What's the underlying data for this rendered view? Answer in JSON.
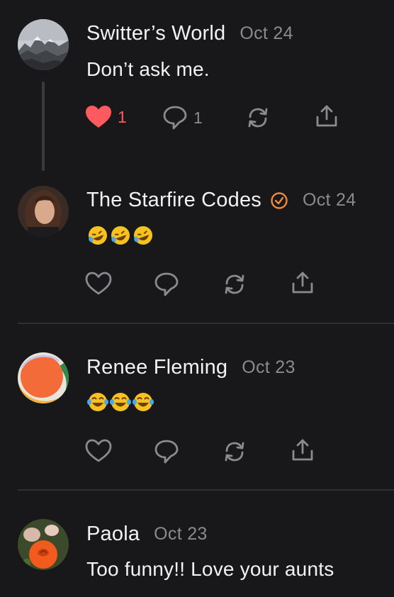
{
  "colors": {
    "background": "#18181a",
    "text": "#f2f2f2",
    "muted": "#8a8a8f",
    "like_active": "#ff5a5f",
    "verified": "#f08a3c"
  },
  "posts": [
    {
      "author": "Switter’s World",
      "date": "Oct 24",
      "text": "Don’t ask me.",
      "avatar": "mountain-landscape-avatar",
      "liked": true,
      "like_count": "1",
      "reply_count": "1"
    },
    {
      "author": "The Starfire Codes",
      "date": "Oct 24",
      "verified": true,
      "emoji": [
        "🤣",
        "🤣",
        "🤣"
      ],
      "avatar": "woman-portrait-avatar",
      "liked": false
    },
    {
      "author": "Renee Fleming",
      "date": "Oct 23",
      "emoji": [
        "😂",
        "😂",
        "😂"
      ],
      "avatar": "orange-circle-avatar",
      "liked": false
    },
    {
      "author": "Paola",
      "date": "Oct 23",
      "text": "Too funny!! Love your aunts",
      "avatar": "rose-flower-avatar"
    }
  ]
}
